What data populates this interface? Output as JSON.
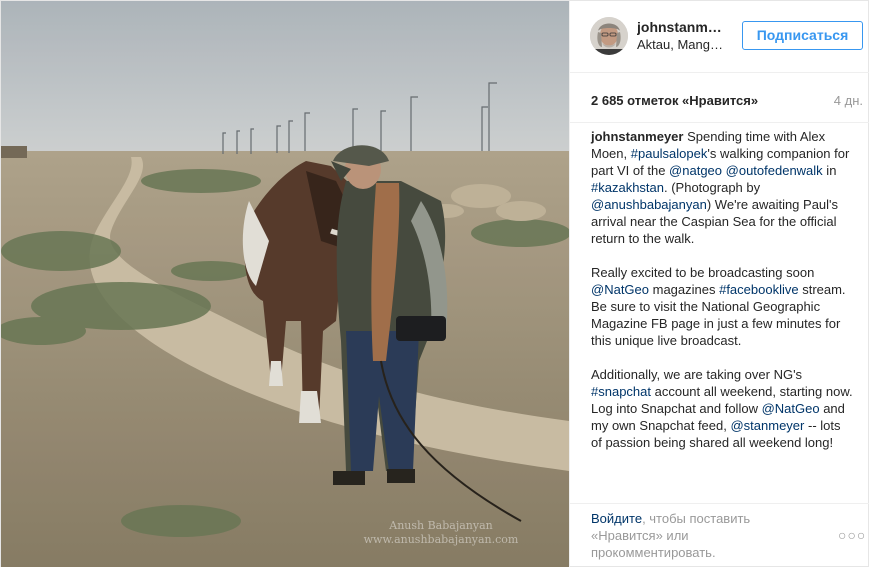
{
  "post": {
    "username": "johnstanmeyer",
    "location": "Aktau, Mangystau",
    "follow_label": "Подписаться",
    "likes": "2 685 отметок «Нравится»",
    "age": "4 дн.",
    "watermark_line1": "Anush Babajanyan",
    "watermark_line2": "www.anushbabajanyan.com"
  },
  "caption": {
    "author": "johnstanmeyer",
    "p1": [
      {
        "text": " Spending time with Alex Moen, ",
        "link": false
      },
      {
        "text": "#paulsalopek",
        "link": true
      },
      {
        "text": "'s walking companion for part VI of the ",
        "link": false
      },
      {
        "text": "@natgeo",
        "link": true
      },
      {
        "text": " ",
        "link": false
      },
      {
        "text": "@outofedenwalk",
        "link": true
      },
      {
        "text": " in ",
        "link": false
      },
      {
        "text": "#kazakhstan",
        "link": true
      },
      {
        "text": ". (Photograph by ",
        "link": false
      },
      {
        "text": "@anushbabajanyan",
        "link": true
      },
      {
        "text": ") We're awaiting Paul's arrival near the Caspian Sea for the official return to the walk.",
        "link": false
      }
    ],
    "p2": [
      {
        "text": "Really excited to be broadcasting soon ",
        "link": false
      },
      {
        "text": "@NatGeo",
        "link": true
      },
      {
        "text": " magazines ",
        "link": false
      },
      {
        "text": "#facebooklive",
        "link": true
      },
      {
        "text": " stream. Be sure to visit the National Geographic Magazine FB page in just a few minutes for this unique live broadcast.",
        "link": false
      }
    ],
    "p3": [
      {
        "text": "Additionally, we are taking over NG's ",
        "link": false
      },
      {
        "text": "#snapchat",
        "link": true
      },
      {
        "text": " account all weekend, starting now. Log into Snapchat and follow ",
        "link": false
      },
      {
        "text": "@NatGeo",
        "link": true
      },
      {
        "text": " and my own Snapchat feed, ",
        "link": false
      },
      {
        "text": "@stanmeyer",
        "link": true
      },
      {
        "text": " -- lots of passion being shared all weekend long!",
        "link": false
      }
    ]
  },
  "footer": {
    "login_link": "Войдите",
    "login_rest": ", чтобы поставить «Нравится» или прокомментировать.",
    "more_label": "○○○"
  },
  "colors": {
    "accent": "#3897f0",
    "link": "#003569",
    "muted": "#999999"
  },
  "icons": {
    "avatar": "avatar-image",
    "more": "more-options-icon"
  }
}
